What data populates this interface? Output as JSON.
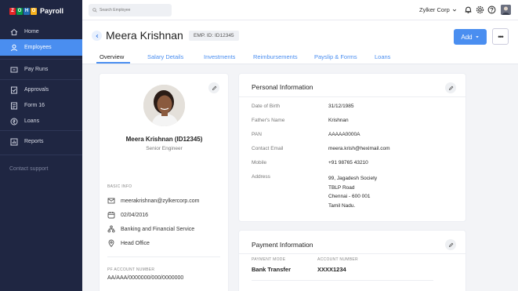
{
  "app": {
    "logo_text": "Payroll",
    "logo_letters": [
      "Z",
      "O",
      "H",
      "O"
    ],
    "logo_colors": [
      "#e42527",
      "#089949",
      "#226db4",
      "#f9b21d"
    ]
  },
  "sidebar": {
    "items": [
      {
        "label": "Home",
        "icon": "home-icon"
      },
      {
        "label": "Employees",
        "icon": "user-icon",
        "active": true
      },
      {
        "label": "Pay Runs",
        "icon": "payrun-icon"
      },
      {
        "label": "Approvals",
        "icon": "approvals-icon"
      },
      {
        "label": "Form 16",
        "icon": "form-icon"
      },
      {
        "label": "Loans",
        "icon": "loans-icon"
      },
      {
        "label": "Reports",
        "icon": "reports-icon"
      }
    ],
    "contact_support": "Contact support"
  },
  "topbar": {
    "search_placeholder": "Search Employee",
    "org_name": "Zylker Corp"
  },
  "header": {
    "employee_name": "Meera Krishnan",
    "employee_id": "EMP. ID: ID12345",
    "add_label": "Add",
    "more_label": "•••",
    "tabs": [
      "Overview",
      "Salary Details",
      "Investments",
      "Reimbursements",
      "Payslip & Forms",
      "Loans"
    ],
    "active_tab": "Overview"
  },
  "profile": {
    "name": "Meera Krishnan (ID12345)",
    "title": "Senior Engineer",
    "basic_info_label": "BASIC INFO",
    "email": "meerakrishnan@zylkercorp.com",
    "date": "02/04/2016",
    "department": "Banking and Financial Service",
    "location": "Head Office",
    "pf_label": "PF ACCOUNT NUMBER",
    "pf_number": "AA/AAA/0000000/000/0000000"
  },
  "personal_info": {
    "title": "Personal Information",
    "fields": [
      {
        "label": "Date of Birth",
        "value": "31/12/1985"
      },
      {
        "label": "Father's Name",
        "value": "Krishnan"
      },
      {
        "label": "PAN",
        "value": "AAAAA0000A"
      },
      {
        "label": "Contact Email",
        "value": "meera.krish@heximail.com"
      },
      {
        "label": "Mobile",
        "value": "+91 98765 43210"
      },
      {
        "label": "Address",
        "value_lines": [
          "99, Jagadesh Society",
          "TBLP Road",
          "Chennai - 600 001",
          "Tamil Nadu."
        ]
      }
    ]
  },
  "payment_info": {
    "title": "Payment Information",
    "mode_label": "PAYMENT MODE",
    "mode_value": "Bank Transfer",
    "account_label": "ACCOUNT NUMBER",
    "account_value": "XXXX1234"
  },
  "colors": {
    "sidebar_bg": "#1f2642",
    "accent": "#4a8ef0"
  }
}
